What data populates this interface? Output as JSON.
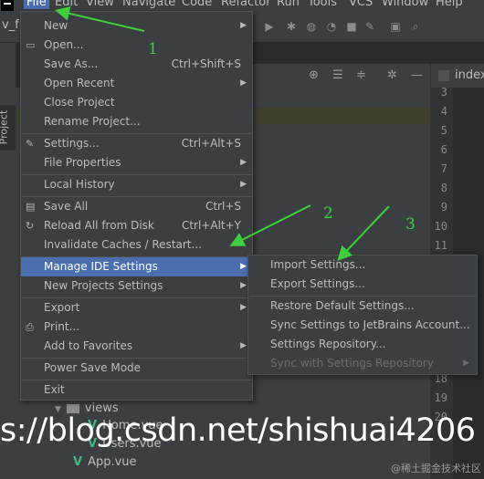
{
  "menubar": {
    "items": [
      {
        "label": "File"
      },
      {
        "label": "Edit"
      },
      {
        "label": "View"
      },
      {
        "label": "Navigate"
      },
      {
        "label": "Code"
      },
      {
        "label": "Refactor"
      },
      {
        "label": "Run"
      },
      {
        "label": "Tools"
      },
      {
        "label": "VCS"
      },
      {
        "label": "Window"
      },
      {
        "label": "Help"
      }
    ]
  },
  "crumb": "v_f",
  "sidebar": {
    "tab": "Project"
  },
  "editor": {
    "tab": "index",
    "line_numbers": [
      "3",
      "4",
      "5",
      "6",
      "7",
      "8",
      "9",
      "10",
      "11",
      "18",
      "19",
      "20"
    ]
  },
  "tree": {
    "views": "views",
    "home": "Home.vue",
    "users": "Users.vue",
    "app": "App.vue"
  },
  "file_menu": {
    "items": [
      {
        "label": "New",
        "shortcut": "",
        "icon": ""
      },
      {
        "label": "Open...",
        "shortcut": "",
        "icon": "folder-icon"
      },
      {
        "label": "Save As...",
        "shortcut": "Ctrl+Shift+S",
        "icon": ""
      },
      {
        "label": "Open Recent",
        "shortcut": "",
        "icon": ""
      },
      {
        "label": "Close Project",
        "shortcut": "",
        "icon": ""
      },
      {
        "label": "Rename Project...",
        "shortcut": "",
        "icon": ""
      },
      {
        "label": "Settings...",
        "shortcut": "Ctrl+Alt+S",
        "icon": "wrench-icon"
      },
      {
        "label": "File Properties",
        "shortcut": "",
        "icon": ""
      },
      {
        "label": "Local History",
        "shortcut": "",
        "icon": ""
      },
      {
        "label": "Save All",
        "shortcut": "Ctrl+S",
        "icon": "save-icon"
      },
      {
        "label": "Reload All from Disk",
        "shortcut": "Ctrl+Alt+Y",
        "icon": "reload-icon"
      },
      {
        "label": "Invalidate Caches / Restart...",
        "shortcut": "",
        "icon": ""
      },
      {
        "label": "Manage IDE Settings",
        "shortcut": "",
        "icon": ""
      },
      {
        "label": "New Projects Settings",
        "shortcut": "",
        "icon": ""
      },
      {
        "label": "Export",
        "shortcut": "",
        "icon": ""
      },
      {
        "label": "Print...",
        "shortcut": "",
        "icon": "print-icon"
      },
      {
        "label": "Add to Favorites",
        "shortcut": "",
        "icon": ""
      },
      {
        "label": "Power Save Mode",
        "shortcut": "",
        "icon": ""
      },
      {
        "label": "Exit",
        "shortcut": "",
        "icon": ""
      }
    ]
  },
  "submenu": {
    "items": [
      {
        "label": "Import Settings..."
      },
      {
        "label": "Export Settings..."
      },
      {
        "label": "Restore Default Settings..."
      },
      {
        "label": "Sync Settings to JetBrains Account..."
      },
      {
        "label": "Settings Repository..."
      },
      {
        "label": "Sync with Settings Repository"
      }
    ]
  },
  "annotations": {
    "a1": "1",
    "a2": "2",
    "a3": "3"
  },
  "watermark": {
    "text": "s://blog.csdn.net/shishuai4206",
    "small": "@稀土掘金技术社区"
  },
  "colors": {
    "accent": "#4b6eaf",
    "arrow": "#3ecf3e",
    "menu_bg": "#3c3f41"
  }
}
